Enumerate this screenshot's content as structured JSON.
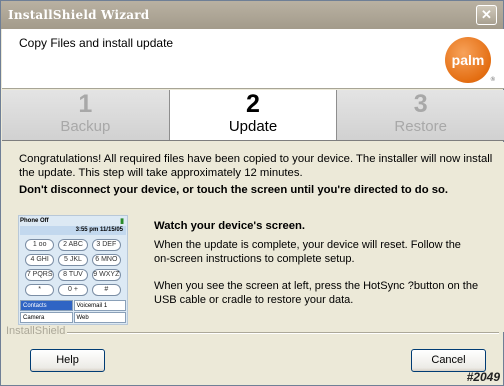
{
  "window": {
    "title": "InstallShield Wizard",
    "close_glyph": "✕"
  },
  "header": {
    "title": "Copy Files and install update",
    "logo_text": "palm",
    "logo_reg": "®"
  },
  "steps": [
    {
      "number": "1",
      "label": "Backup",
      "active": false
    },
    {
      "number": "2",
      "label": "Update",
      "active": true
    },
    {
      "number": "3",
      "label": "Restore",
      "active": false
    }
  ],
  "content": {
    "message": "Congratulations! All required files have been copied to your device. The installer will now install the update. This step will take approximately 12 minutes.",
    "warning": "Don't disconnect your device, or touch the screen until you're directed to do so.",
    "watch_title": "Watch your device's screen.",
    "paragraph1": "When the update is complete, your device will reset. Follow the on-screen instructions to complete setup.",
    "paragraph2": "When you see the screen at left, press the HotSync ?button on the USB cable or cradle to restore your data."
  },
  "device_screen": {
    "status": "Phone Off",
    "datetime": "3:55 pm 11/15/05",
    "keys": [
      "1 oo",
      "2 ABC",
      "3 DEF",
      "4 GHI",
      "5 JKL",
      "6 MNO",
      "7 PQRS",
      "8 TUV",
      "9 WXYZ",
      "*",
      "0 +",
      "#"
    ],
    "apps": [
      "Contacts",
      "Voicemail 1",
      "Camera",
      "Web"
    ]
  },
  "footer": {
    "brand": "InstallShield",
    "help_label": "Help",
    "cancel_label": "Cancel"
  },
  "watermark": "#2049"
}
